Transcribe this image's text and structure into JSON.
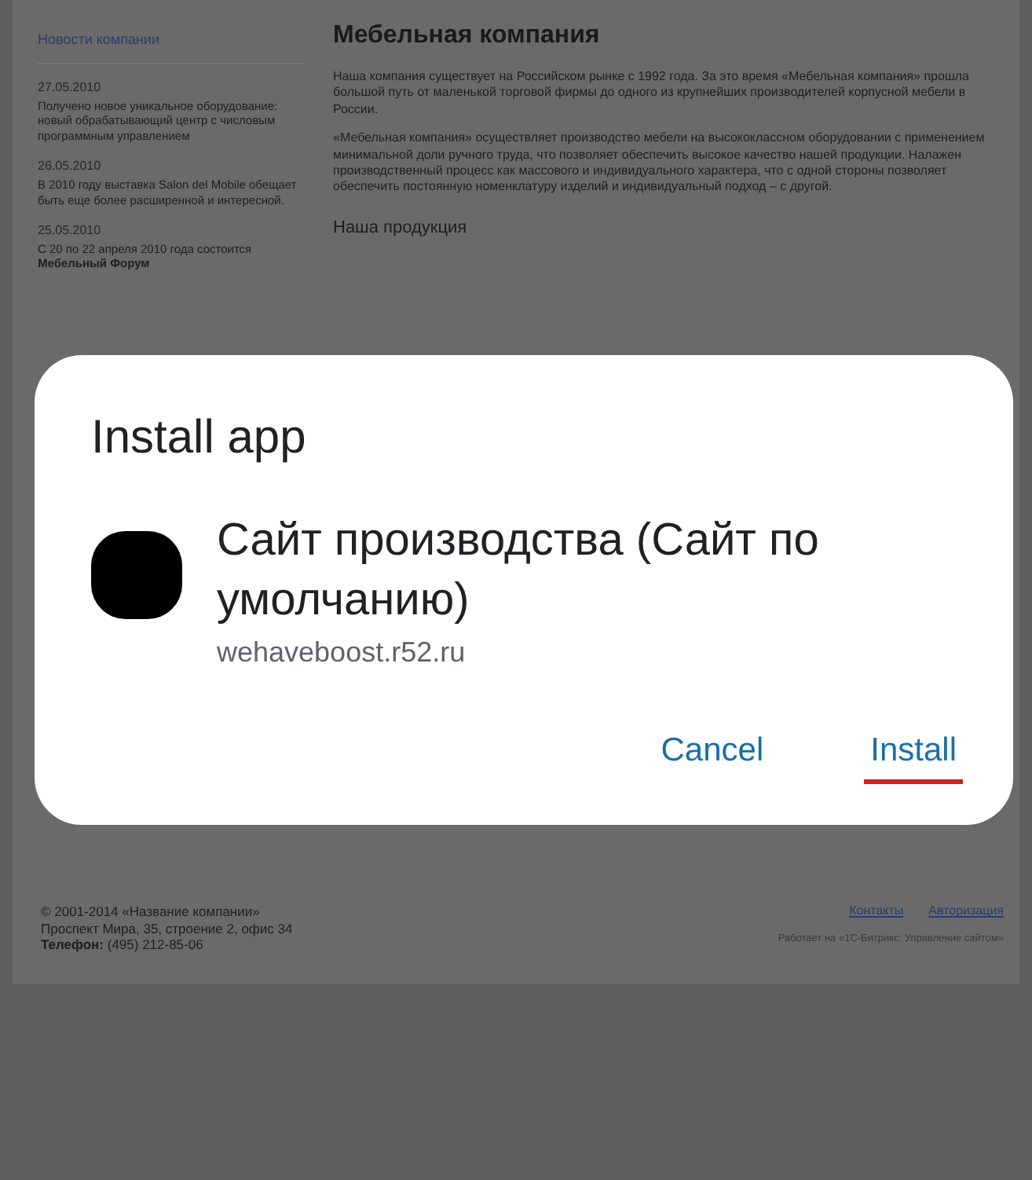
{
  "sidebar": {
    "title": "Новости компании",
    "news": [
      {
        "date": "27.05.2010",
        "text": "Получено новое уникальное оборудование: новый обрабатывающий центр с числовым программным управлением"
      },
      {
        "date": "26.05.2010",
        "text": "В 2010 году выставка Salon del Mobile обещает быть еще более расширенной и интересной."
      },
      {
        "date": "25.05.2010",
        "text": "С 20 по 22 апреля 2010 года состоится **Мебельный Форум**"
      }
    ]
  },
  "main": {
    "title": "Мебельная компания",
    "paragraphs": [
      "Наша компания существует на Российском рынке с 1992 года. За это время «Мебельная компания» прошла большой путь от маленькой торговой фирмы до одного из крупнейших производителей корпусной мебели в России.",
      "«Мебельная компания» осуществляет производство мебели на высококлассном оборудовании с применением минимальной доли ручного труда, что позволяет обеспечить высокое качество нашей продукции. Налажен производственный процесс как массового и индивидуального характера, что с одной стороны позволяет обеспечить постоянную номенклатуру изделий и индивидуальный подход – с другой."
    ],
    "subtitle": "Наша продукция"
  },
  "dialog": {
    "title": "Install app",
    "app_name": "Сайт производства (Сайт по умолчанию)",
    "url": "wehaveboost.r52.ru",
    "buttons": [
      {
        "label": "Cancel",
        "highlighted": false
      },
      {
        "label": "Install",
        "highlighted": true
      }
    ]
  },
  "footer": {
    "copyright": "© 2001-2014 «Название компании»",
    "address": "Проспект Мира, 35, строение 2, офис 34",
    "phone": "**Телефон:** (495) 212-85-06",
    "links": [
      "Контакты",
      "Авторизация"
    ],
    "powered": "Работает на «1С-Битрикс: Управление сайтом»"
  }
}
